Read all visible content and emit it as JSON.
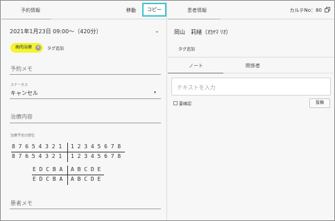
{
  "left": {
    "header": {
      "tab_label": "予約情報",
      "move_label": "移動",
      "copy_label": "コピー"
    },
    "datetime": "2021年1月23日 09:00〜（420分）",
    "tag": "歯肉治療",
    "tag_add": "タグ追加",
    "fields": {
      "memo_label": "予約メモ",
      "status_label": "ステータス",
      "status_value": "キャンセル",
      "treatment_label": "治療内容",
      "teeth_label": "治療予定の部位",
      "patient_memo_label": "患者メモ"
    },
    "teeth": {
      "upper_left": "8 7 6 5 4 3 2 1",
      "upper_right": "1 2 3 4 5 6 7 8",
      "lower_left": "8 7 6 5 4 3 2 1",
      "lower_right": "1 2 3 4 5 6 7 8",
      "baby_upper_left": "E D C B A",
      "baby_upper_right": "A B C D E",
      "baby_lower_left": "E D C B A",
      "baby_lower_right": "A B C D E"
    }
  },
  "right": {
    "header": {
      "tab_label": "患者情報",
      "karte_label": "カルテNo：80"
    },
    "patient_name": "岡山　莉緒（ｵｶﾔﾏ ﾘｵ）",
    "tag_add": "タグ追加",
    "tabs": [
      "ノート",
      "関係者"
    ],
    "note_placeholder": "テキストを入力",
    "confirm_label": "要確認",
    "post_label": "投稿"
  }
}
